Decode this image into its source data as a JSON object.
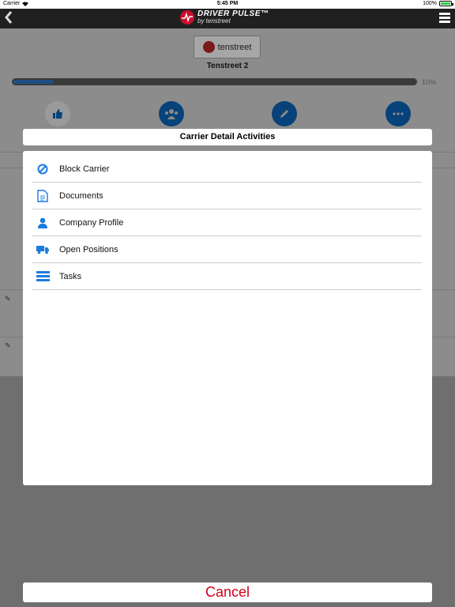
{
  "status_bar": {
    "carrier": "Carrier",
    "time": "5:45 PM",
    "battery": "100%"
  },
  "nav": {
    "logo_title": "DRIVER PULSE™",
    "logo_subtitle": "by tenstreet"
  },
  "company": {
    "badge_text": "tenstreet",
    "name": "Tenstreet 2",
    "progress_label": "10%",
    "progress_fraction": 0.1
  },
  "modal": {
    "title": "Carrier Detail Activities",
    "items": [
      {
        "label": "Block Carrier",
        "icon": "block-icon"
      },
      {
        "label": "Documents",
        "icon": "document-icon"
      },
      {
        "label": "Company Profile",
        "icon": "person-icon"
      },
      {
        "label": "Open Positions",
        "icon": "truck-icon"
      },
      {
        "label": "Tasks",
        "icon": "tasks-icon"
      }
    ],
    "cancel_label": "Cancel"
  },
  "colors": {
    "accent": "#1a7be0",
    "cancel": "#d0021b",
    "nav": "#202020"
  }
}
